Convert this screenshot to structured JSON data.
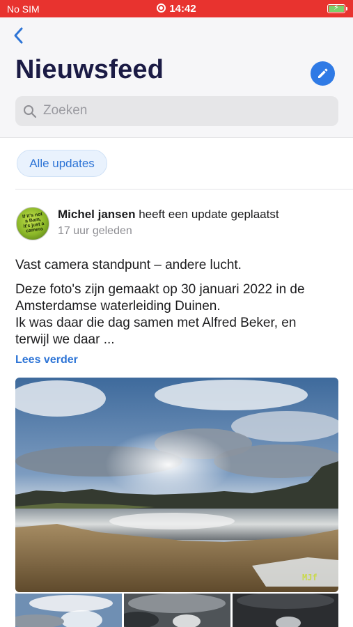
{
  "status_bar": {
    "carrier": "No SIM",
    "time": "14:42"
  },
  "header": {
    "title": "Nieuwsfeed"
  },
  "search": {
    "placeholder": "Zoeken"
  },
  "filter": {
    "label": "Alle updates"
  },
  "post": {
    "author": "Michel jansen",
    "action": "heeft een update geplaatst",
    "time_ago": "17 uur geleden",
    "avatar_text": "If it's not a Bam, it's just a camera",
    "title": "Vast camera standpunt – andere lucht.",
    "body_lines": [
      "Deze foto's zijn gemaakt op  30 januari 2022 in de",
      "Amsterdamse waterleiding Duinen.",
      "Ik was daar die dag samen met Alfred Beker, en",
      "terwijl we daar ..."
    ],
    "read_more": "Lees verder",
    "photo_watermark": "MJf"
  },
  "icons": {
    "back": "chevron-left-icon",
    "edit": "pencil-icon",
    "search": "search-icon",
    "rec": "record-icon",
    "battery": "battery-charging-icon"
  },
  "colors": {
    "status_bar": "#e8332f",
    "accent": "#2d74d6",
    "edit_button": "#2f7ae5",
    "title": "#1b1b45"
  }
}
